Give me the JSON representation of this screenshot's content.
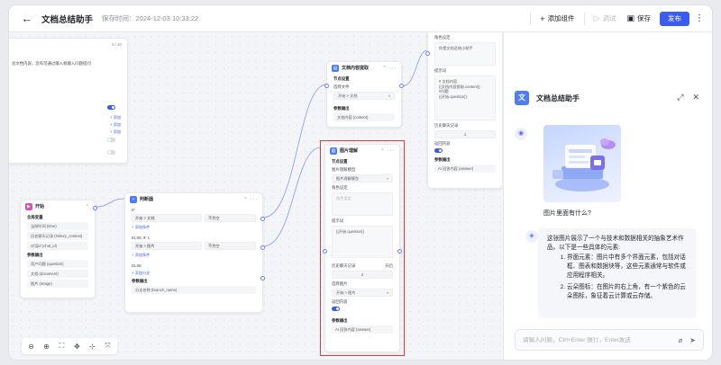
{
  "topbar": {
    "title": "文档总结助手",
    "save_time": "保存时间：2024-12-03 10:33:22",
    "add_component": "添加组件",
    "debug": "调试",
    "save": "保存",
    "publish": "发布"
  },
  "canvas": {
    "left_panel": {
      "line1": "3 / 20",
      "line2": "总文档内容，您有可通过输入框输入问题提问",
      "link1": "+ 添加",
      "link2": "+ 添加",
      "link3": "+ 添加"
    },
    "start_node": {
      "title": "开始",
      "sec_global": "全局变量",
      "items": [
        "当前时间 (time)",
        "历史聊天记录 (history_context)",
        "对话id (chat_id)"
      ],
      "sec_params": "参数输出",
      "params": [
        "用户问题 (question)",
        "文档 (document)",
        "图片 (image)"
      ]
    },
    "judge_node": {
      "title": "判断器",
      "if_label": "IF",
      "if_left": "开始 > 文档",
      "if_op": "不为空",
      "if_add": "+ 添加条件",
      "elseif_label": "ELSE IF 1",
      "elseif_left": "开始 > 图片",
      "elseif_op": "不为空",
      "elseif_add": "+ 添加条件",
      "else_label": "ELSE",
      "add_branch": "+ 添加分支",
      "out_sec": "参数输出",
      "out_val": "分支名称 (branch_name)"
    },
    "doc_node": {
      "title": "文档内容提取",
      "sec": "节点设置",
      "file_label": "选择文件",
      "file_val": "开始 > 文档",
      "out_sec": "参数输出",
      "out_val": "文档内容 (content)"
    },
    "img_node": {
      "title": "图片理解",
      "sec": "节点设置",
      "model_label": "图片理解模型",
      "model_val": "图片理解模型",
      "role_label": "角色设定",
      "role_ph": "角色设定",
      "prompt_label": "提示词",
      "prompt_val": "{{开始.question}}",
      "history_label": "历史聊天记录",
      "history_mode": "开启",
      "history_num": "2",
      "pic_label": "选择图片",
      "pic_val": "开始 > 图片",
      "ret_label": "返回内容",
      "out_sec": "参数输出",
      "out_val": "AI 回答内容 (answer)"
    },
    "ai_node": {
      "role_label": "角色设定",
      "role_val": "你是文档总结小助手",
      "prompt_label": "提示词",
      "prompt_val": "# 文档内容\n{{文档内容提取.content}}\n#问题\n{{开始.question}}",
      "history_label": "历史聊天记录",
      "history_num": "1",
      "ret_label": "返回内容",
      "out_sec": "参数输出",
      "out_val": "AI 回答内容 (answer)"
    },
    "zoom": {
      "zoom_out": "⊖",
      "zoom_in": "⊕",
      "fit": "⛶",
      "drag": "✥",
      "layout": "⊹",
      "reset": "⤧"
    }
  },
  "chat": {
    "title": "文档总结助手",
    "logo": "文",
    "user_caption": "图片里面有什么?",
    "reply_intro": "这张图片展示了一个与技术和数据相关的抽象艺术作品。以下是一些具体的元素:",
    "reply_items": [
      "界面元素：图片中有多个界面元素，包括对话框、图表和数据块等，这些元素通常与软件或应用程序相关。",
      "云朵图标：在图片的右上角，有一个紫色的云朵图标，象征着云计算或云存储。"
    ],
    "input_placeholder": "请输入问题，Ctrl+Enter 换行，Enter发送"
  },
  "colors": {
    "accent": "#3a5cf5",
    "selection": "#e03a3a"
  }
}
